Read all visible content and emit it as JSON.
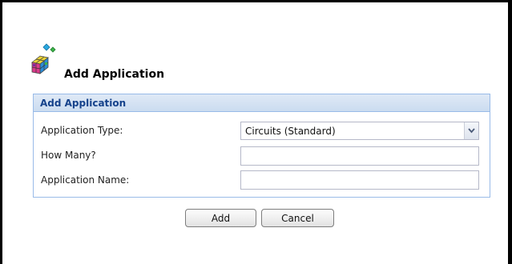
{
  "window": {
    "title": "Add Application",
    "icon": "add-application-icon"
  },
  "panel": {
    "title": "Add Application",
    "header_color": "#dfe9f6",
    "border_color": "#99bbe8"
  },
  "form": {
    "application_type": {
      "label": "Application Type:",
      "selected": "Circuits (Standard)"
    },
    "how_many": {
      "label": "How Many?",
      "value": ""
    },
    "application_name": {
      "label": "Application Name:",
      "value": ""
    }
  },
  "buttons": {
    "add_label": "Add",
    "cancel_label": "Cancel"
  }
}
